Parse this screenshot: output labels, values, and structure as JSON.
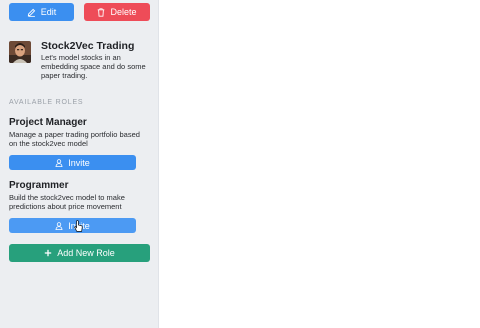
{
  "toolbar": {
    "edit_label": "Edit",
    "delete_label": "Delete",
    "edit_icon": "pencil-icon",
    "delete_icon": "trash-icon"
  },
  "project": {
    "title": "Stock2Vec Trading",
    "description": "Let's model stocks in an embedding space and do some paper trading."
  },
  "roles_section": {
    "label": "AVAILABLE ROLES",
    "roles": [
      {
        "title": "Project Manager",
        "description": "Manage a paper trading portfolio based on the stock2vec model",
        "invite_label": "Invite"
      },
      {
        "title": "Programmer",
        "description": "Build the stock2vec model to make predictions about price movement",
        "invite_label": "Invite"
      }
    ],
    "add_role_label": "Add New Role"
  },
  "colors": {
    "primary": "#3b8ff0",
    "danger": "#ee4c58",
    "success": "#27a07c",
    "sidebar_bg": "#eceef1"
  }
}
